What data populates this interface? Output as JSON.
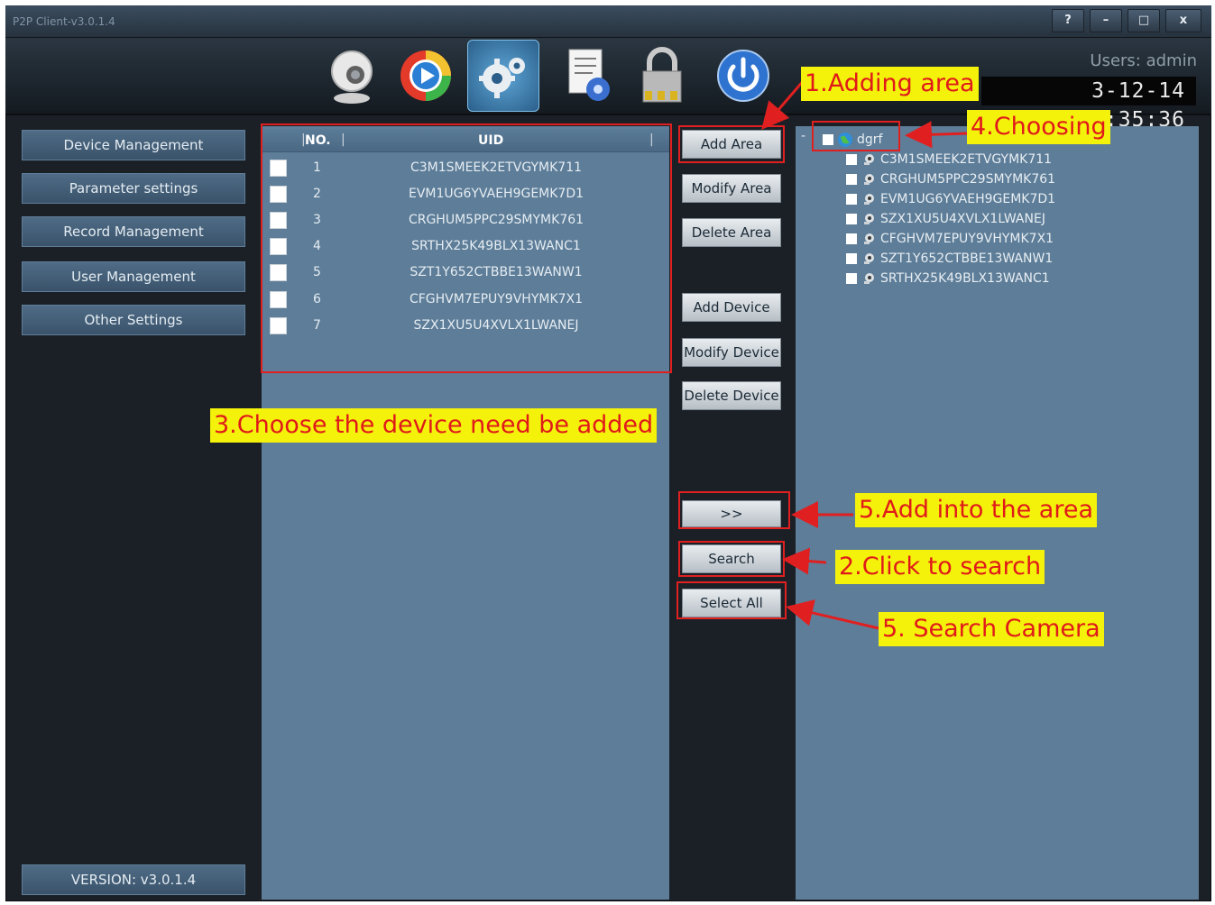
{
  "window": {
    "title": "P2P Client-v3.0.1.4",
    "controls": [
      "?",
      "–",
      "□",
      "x"
    ]
  },
  "toolbar": {
    "icons": [
      "webcam-icon",
      "playback-icon",
      "settings-gear-icon",
      "document-settings-icon",
      "lock-icon",
      "power-icon"
    ],
    "selected": "settings-gear-icon"
  },
  "header": {
    "users_label": "Users: admin",
    "clock": "3-12-14 10:35:36"
  },
  "sidebar": {
    "items": [
      {
        "label": "Device Management"
      },
      {
        "label": "Parameter settings"
      },
      {
        "label": "Record Management"
      },
      {
        "label": "User Management"
      },
      {
        "label": "Other Settings"
      }
    ],
    "version": "VERSION: v3.0.1.4"
  },
  "device_table": {
    "columns": [
      "NO.",
      "UID"
    ],
    "rows": [
      {
        "no": "1",
        "uid": "C3M1SMEEK2ETVGYMK711"
      },
      {
        "no": "2",
        "uid": "EVM1UG6YVAEH9GEMK7D1"
      },
      {
        "no": "3",
        "uid": "CRGHUM5PPC29SMYMK761"
      },
      {
        "no": "4",
        "uid": "SRTHX25K49BLX13WANC1"
      },
      {
        "no": "5",
        "uid": "SZT1Y652CTBBE13WANW1"
      },
      {
        "no": "6",
        "uid": "CFGHVM7EPUY9VHYMK7X1"
      },
      {
        "no": "7",
        "uid": "SZX1XU5U4XVLX1LWANEJ"
      }
    ]
  },
  "actions": {
    "add_area": "Add Area",
    "modify_area": "Modify Area",
    "delete_area": "Delete Area",
    "add_device": "Add Device",
    "modify_device": "Modify Device",
    "delete_device": "Delete Device",
    "move": ">>",
    "search": "Search",
    "select_all": "Select All"
  },
  "area_tree": {
    "expander": "-",
    "root": "dgrf",
    "devices": [
      "C3M1SMEEK2ETVGYMK711",
      "CRGHUM5PPC29SMYMK761",
      "EVM1UG6YVAEH9GEMK7D1",
      "SZX1XU5U4XVLX1LWANEJ",
      "CFGHVM7EPUY9VHYMK7X1",
      "SZT1Y652CTBBE13WANW1",
      "SRTHX25K49BLX13WANC1"
    ]
  },
  "annotations": {
    "adding_area": "1.Adding area",
    "choosing": "4.Choosing",
    "choose_device": "3.Choose the device need be added",
    "add_into_area": "5.Add into the area",
    "click_search": "2.Click to search",
    "search_camera": "5. Search Camera"
  },
  "colors": {
    "annotation_bg": "#f4f20a",
    "annotation_text": "#e01a1a",
    "panel": "#5d7d98",
    "window": "#1b2026"
  }
}
